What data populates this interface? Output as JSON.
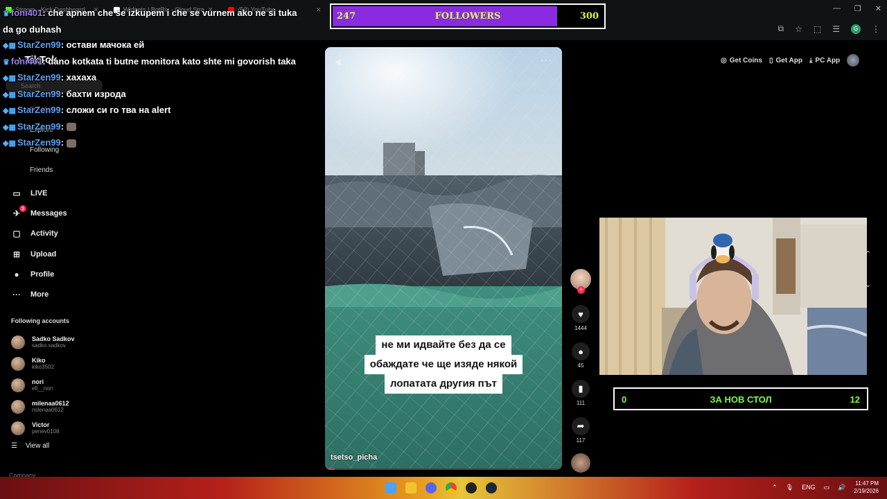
{
  "browser": {
    "tabs": [
      {
        "label": "Stream - Kick Dashboard",
        "color": "#53fc18"
      },
      {
        "label": "Widgets | BotRix - Cloud Stre",
        "color": "#ffffff"
      },
      {
        "label": "(53) YouTube",
        "color": "#ff0000"
      }
    ],
    "profile_initial": "G"
  },
  "sidebar": {
    "logo": "TikTok",
    "search_placeholder": "Search",
    "ghost_items": [
      "For You",
      "Explore",
      "Following",
      "Friends"
    ],
    "nav": [
      {
        "label": "LIVE",
        "icon": "live-icon",
        "glyph": "▭"
      },
      {
        "label": "Messages",
        "icon": "messages-icon",
        "glyph": "✈",
        "badge": "1"
      },
      {
        "label": "Activity",
        "icon": "activity-icon",
        "glyph": "▢"
      },
      {
        "label": "Upload",
        "icon": "upload-icon",
        "glyph": "⊞"
      },
      {
        "label": "Profile",
        "icon": "profile-icon",
        "glyph": "●"
      },
      {
        "label": "More",
        "icon": "more-icon",
        "glyph": "···"
      }
    ],
    "following_title": "Following accounts",
    "accounts": [
      {
        "name": "Sadko Sadkov",
        "handle": "sadko.sadkov"
      },
      {
        "name": "Kiko",
        "handle": "kiko3502"
      },
      {
        "name": "nori",
        "handle": "ell__nori"
      },
      {
        "name": "milenaa0612",
        "handle": "milenaa0612"
      },
      {
        "name": "Victor",
        "handle": "penev0108"
      }
    ],
    "view_all": "View all",
    "company": "Company"
  },
  "chat": [
    {
      "user": "foni401",
      "purple": true,
      "text": ": che apnem che se izkupem i che se vurnem ako ne si tuka da go duhash"
    },
    {
      "user": "StarZen99",
      "text": ": остави мачока ей"
    },
    {
      "user": "foni401",
      "purple": true,
      "text": ": dano kotkata ti butne monitora kato shte mi govorish taka"
    },
    {
      "user": "StarZen99",
      "text": ": хахаха"
    },
    {
      "user": "StarZen99",
      "text": ": бахти изрода"
    },
    {
      "user": "StarZen99",
      "text": ": сложи си го тва на alert"
    },
    {
      "user": "StarZen99",
      "text": ":",
      "emote": true
    },
    {
      "user": "StarZen99",
      "text": ":",
      "emote": true
    }
  ],
  "followers": {
    "current": 247,
    "label": "FOLLOWERS",
    "goal": 300,
    "fill_color": "#8a2be2"
  },
  "top_actions": {
    "coins": "Get Coins",
    "app": "Get App",
    "pc": "PC App"
  },
  "video": {
    "caption_lines": [
      "не ми идвайте без да се",
      "обаждате че ще изяде някой",
      "лопатата другия път"
    ],
    "author": "tsetso_picha",
    "progress": 0.04
  },
  "rail": {
    "likes": "1444",
    "comments": "45",
    "saves": "111",
    "shares": "117"
  },
  "goal": {
    "current": "0",
    "label": "ЗА НОВ СТОЛ",
    "target": "12"
  },
  "taskbar": {
    "lang": "ENG",
    "time": "11:47 PM",
    "date": "2/19/2026"
  }
}
